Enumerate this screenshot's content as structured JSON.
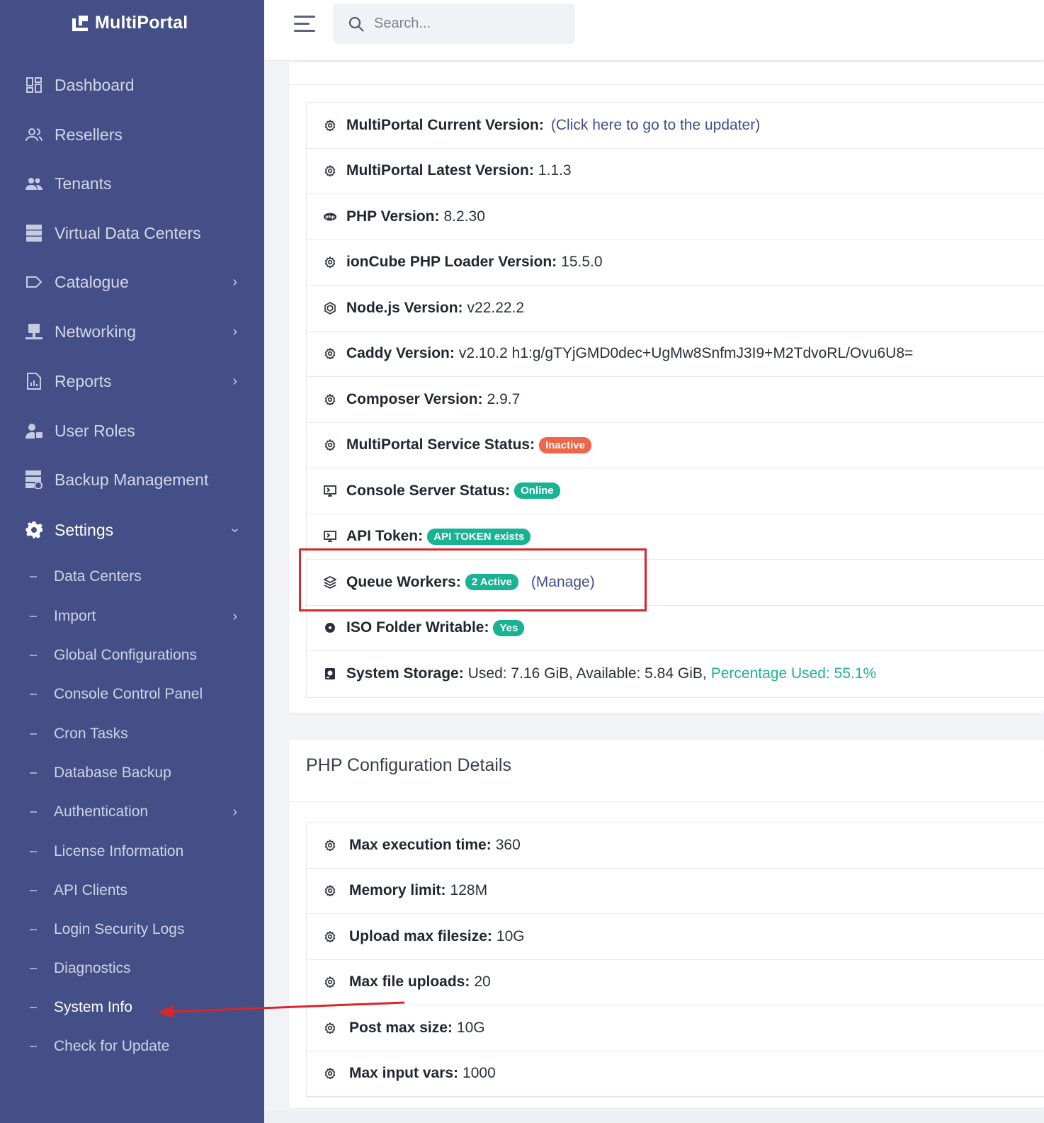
{
  "brand": {
    "name": "MultiPortal"
  },
  "search": {
    "placeholder": "Search..."
  },
  "sidebar": {
    "items": [
      {
        "label": "Dashboard",
        "icon": "dashboard-icon"
      },
      {
        "label": "Resellers",
        "icon": "resellers-icon"
      },
      {
        "label": "Tenants",
        "icon": "tenants-icon"
      },
      {
        "label": "Virtual Data Centers",
        "icon": "server-icon"
      },
      {
        "label": "Catalogue",
        "icon": "tag-icon"
      },
      {
        "label": "Networking",
        "icon": "network-icon"
      },
      {
        "label": "Reports",
        "icon": "report-icon"
      },
      {
        "label": "User Roles",
        "icon": "user-roles-icon"
      },
      {
        "label": "Backup Management",
        "icon": "backup-icon"
      },
      {
        "label": "Settings",
        "icon": "gear-icon"
      }
    ],
    "settings_subitems": [
      {
        "label": "Data Centers"
      },
      {
        "label": "Import"
      },
      {
        "label": "Global Configurations"
      },
      {
        "label": "Console Control Panel"
      },
      {
        "label": "Cron Tasks"
      },
      {
        "label": "Database Backup"
      },
      {
        "label": "Authentication"
      },
      {
        "label": "License Information"
      },
      {
        "label": "API Clients"
      },
      {
        "label": "Login Security Logs"
      },
      {
        "label": "Diagnostics"
      },
      {
        "label": "System Info"
      },
      {
        "label": "Check for Update"
      }
    ]
  },
  "system_info": {
    "rows": [
      {
        "label": "MultiPortal Current Version:",
        "link": "(Click here to go to the updater)",
        "icon": "gear-icon"
      },
      {
        "label": "MultiPortal Latest Version:",
        "value": "1.1.3",
        "icon": "gear-icon"
      },
      {
        "label": "PHP Version:",
        "value": "8.2.30",
        "icon": "php-icon"
      },
      {
        "label": "ionCube PHP Loader Version:",
        "value": "15.5.0",
        "icon": "gear-icon"
      },
      {
        "label": "Node.js Version:",
        "value": "v22.22.2",
        "icon": "nodejs-icon"
      },
      {
        "label": "Caddy Version:",
        "value": "v2.10.2 h1:g/gTYjGMD0dec+UgMw8SnfmJ3I9+M2TdvoRL/Ovu6U8=",
        "icon": "gear-icon"
      },
      {
        "label": "Composer Version:",
        "value": "2.9.7",
        "icon": "gear-icon"
      },
      {
        "label": "MultiPortal Service Status:",
        "badge": "Inactive",
        "icon": "gear-icon"
      },
      {
        "label": "Console Server Status:",
        "badge": "Online",
        "icon": "console-icon"
      },
      {
        "label": "API Token:",
        "badge": "API TOKEN exists",
        "icon": "console-icon"
      },
      {
        "label": "Queue Workers:",
        "badge": "2 Active",
        "link": "(Manage)",
        "icon": "layers-icon"
      },
      {
        "label": "ISO Folder Writable:",
        "badge": "Yes",
        "icon": "disc-icon"
      },
      {
        "label": "System Storage:",
        "value": "Used: 7.16 GiB, Available: 5.84 GiB,",
        "highlight": "Percentage Used: 55.1%",
        "icon": "storage-icon"
      }
    ]
  },
  "php_config": {
    "title": "PHP Configuration Details",
    "rows": [
      {
        "label": "Max execution time:",
        "value": "360"
      },
      {
        "label": "Memory limit:",
        "value": "128M"
      },
      {
        "label": "Upload max filesize:",
        "value": "10G"
      },
      {
        "label": "Max file uploads:",
        "value": "20"
      },
      {
        "label": "Post max size:",
        "value": "10G"
      },
      {
        "label": "Max input vars:",
        "value": "1000"
      }
    ]
  },
  "colors": {
    "sidebar": "#434f86",
    "badge_red": "#ee6547",
    "badge_green": "#19b394",
    "link_green": "#20b38e",
    "annotation_red": "#d9262b"
  }
}
